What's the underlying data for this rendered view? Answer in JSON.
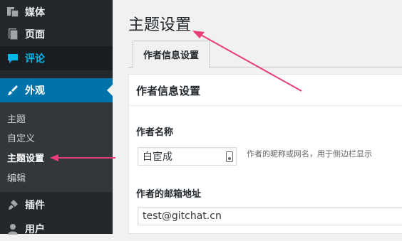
{
  "sidebar": {
    "items": [
      {
        "label": "媒体",
        "icon": "media-icon"
      },
      {
        "label": "页面",
        "icon": "page-icon"
      },
      {
        "label": "评论",
        "icon": "comment-icon"
      },
      {
        "label": "外观",
        "icon": "brush-icon"
      },
      {
        "label": "插件",
        "icon": "plugin-icon"
      },
      {
        "label": "用户",
        "icon": "user-icon"
      }
    ],
    "submenu": [
      "主题",
      "自定义",
      "主题设置",
      "编辑"
    ]
  },
  "main": {
    "title": "主题设置",
    "tab_label": "作者信息设置",
    "panel_title": "作者信息设置",
    "fields": {
      "author_name_label": "作者名称",
      "author_name_value": "白宦成",
      "author_name_description": "作者的昵称或网名，用于侧边栏显示",
      "author_email_label": "作者的邮箱地址",
      "author_email_value": "test@gitchat.cn"
    }
  },
  "colors": {
    "sidebar_bg": "#23282d",
    "submenu_bg": "#32373c",
    "active_bg": "#0073aa",
    "comment_highlight": "#00b9eb",
    "annotation_arrow": "#e83e7b"
  }
}
